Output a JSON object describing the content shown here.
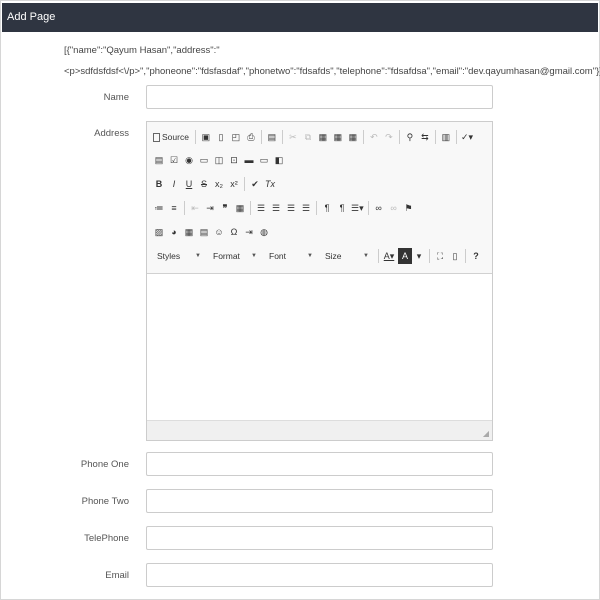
{
  "header": {
    "title": "Add Page"
  },
  "json_dump": {
    "line1": "[{\"name\":\"Qayum Hasan\",\"address\":\"",
    "line2": "<p>sdfdsfdsf<\\/p>\",\"phoneone\":\"fdsfasdaf\",\"phonetwo\":\"fdsafds\",\"telephone\":\"fdsafdsa\",\"email\":\"dev.qayumhasan@gmail.com\"}]"
  },
  "form": {
    "name_label": "Name",
    "address_label": "Address",
    "phone_one_label": "Phone One",
    "phone_two_label": "Phone Two",
    "telephone_label": "TelePhone",
    "email_label": "Email"
  },
  "editor": {
    "source_label": "Source",
    "styles_label": "Styles",
    "format_label": "Format",
    "font_label": "Font",
    "size_label": "Size",
    "help_label": "?",
    "row3": [
      "B",
      "I",
      "U",
      "S",
      "x₂",
      "x²",
      "✔",
      "Tx"
    ],
    "omega": "Ω"
  }
}
